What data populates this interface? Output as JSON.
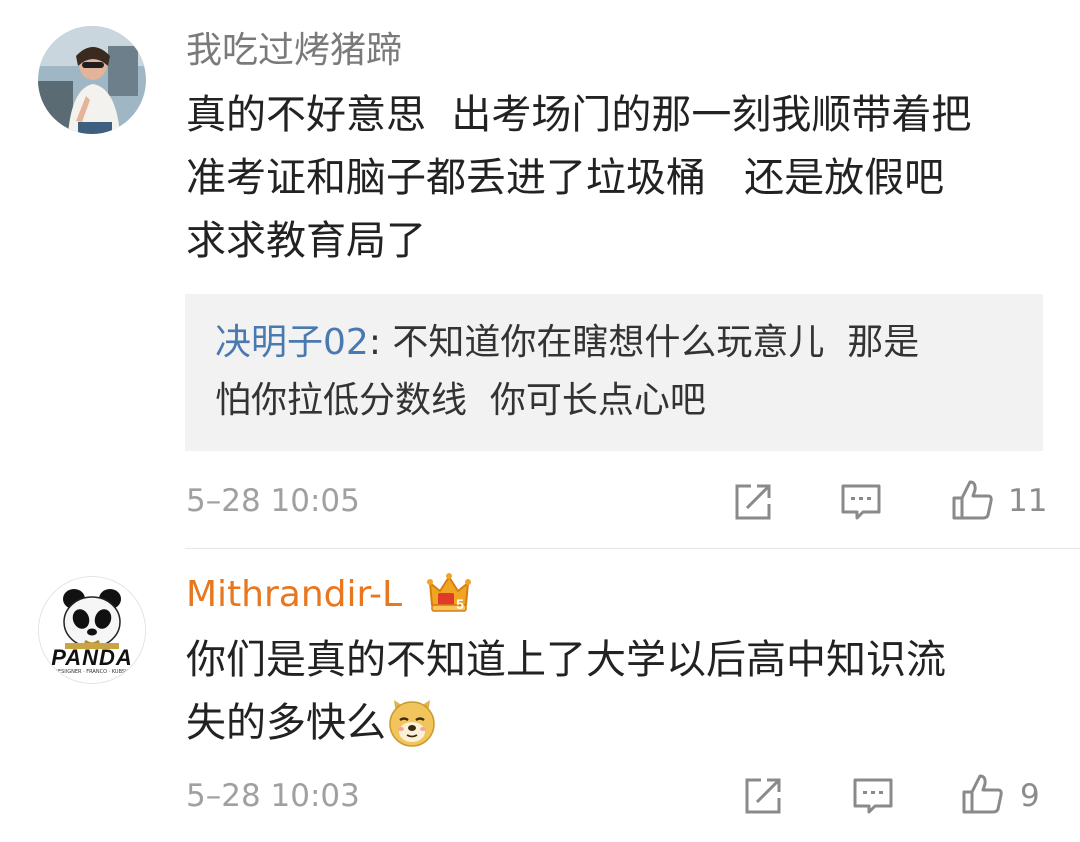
{
  "comments": [
    {
      "username": "我吃过烤猪蹄",
      "text_lines": [
        "真的不好意思  出考场门的那一刻我顺带着把",
        "准考证和脑子都丢进了垃圾桶   还是放假吧",
        "求求教育局了"
      ],
      "reply": {
        "user": "决明子02",
        "separator": ": ",
        "line1": "不知道你在瞎想什么玩意儿  那是",
        "line2": "怕你拉低分数线  你可长点心吧"
      },
      "timestamp": "5–28 10:05",
      "likes": "11",
      "icons": [
        "avatar-photo",
        "share-icon",
        "comment-icon",
        "like-icon"
      ]
    },
    {
      "username": "Mithrandir-L",
      "text_lines": [
        "你们是真的不知道上了大学以后高中知识流",
        "失的多快么"
      ],
      "avatar_text": "PANDA",
      "avatar_subtext": "DESIIGNER · FRANCO · KUBSKI",
      "vip_badge_text": "5",
      "timestamp": "5–28 10:03",
      "likes": "9",
      "icons": [
        "panda-avatar",
        "vip-crown-icon",
        "doge-emoji",
        "share-icon",
        "comment-icon",
        "like-icon"
      ]
    }
  ],
  "colors": {
    "username_grey": "#7a7a7a",
    "username_vip": "#e8771f",
    "reply_user_blue": "#4a79b0",
    "body_text": "#222222",
    "meta_text": "#a0a0a0",
    "reply_bg": "#f2f2f2"
  }
}
